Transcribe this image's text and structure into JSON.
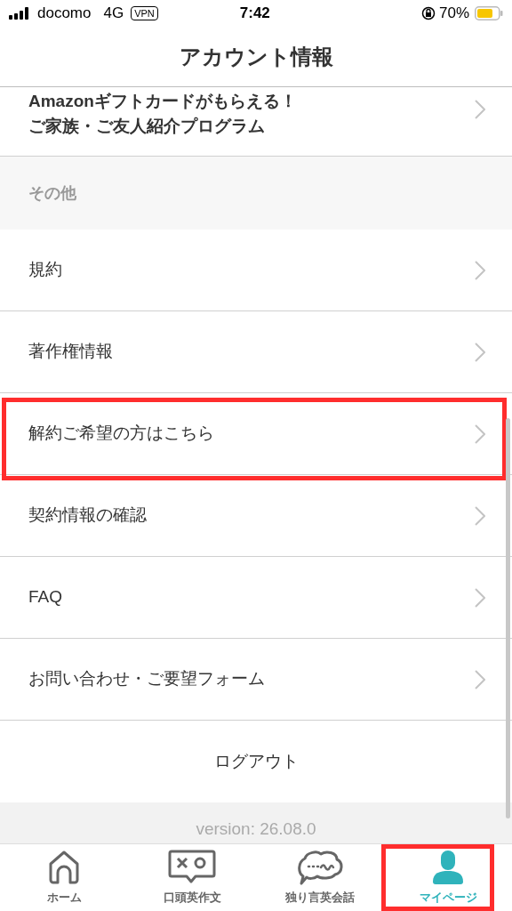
{
  "status_bar": {
    "carrier": "docomo",
    "network": "4G",
    "vpn": "VPN",
    "time": "7:42",
    "battery": "70%"
  },
  "header": {
    "title": "アカウント情報"
  },
  "promo": {
    "lines": [
      "Amazonギフトカードがもらえる！",
      "ご家族・ご友人紹介プログラム"
    ]
  },
  "section": {
    "title": "その他"
  },
  "menu_items": [
    {
      "label": "規約",
      "highlighted": false
    },
    {
      "label": "著作権情報",
      "highlighted": false
    },
    {
      "label": "解約ご希望の方はこちら",
      "highlighted": true
    },
    {
      "label": "契約情報の確認",
      "highlighted": false
    },
    {
      "label": "FAQ",
      "highlighted": false
    },
    {
      "label": "お問い合わせ・ご要望フォーム",
      "highlighted": false
    }
  ],
  "logout": {
    "label": "ログアウト"
  },
  "version": "version: 26.08.0",
  "tabs": [
    {
      "label": "ホーム",
      "kind": "home",
      "selected": false,
      "highlighted": false
    },
    {
      "label": "口頭英作文",
      "kind": "quiz",
      "selected": false,
      "highlighted": false
    },
    {
      "label": "独り言英会話",
      "kind": "chat",
      "selected": false,
      "highlighted": false
    },
    {
      "label": "マイページ",
      "kind": "person",
      "selected": true,
      "highlighted": true
    }
  ]
}
